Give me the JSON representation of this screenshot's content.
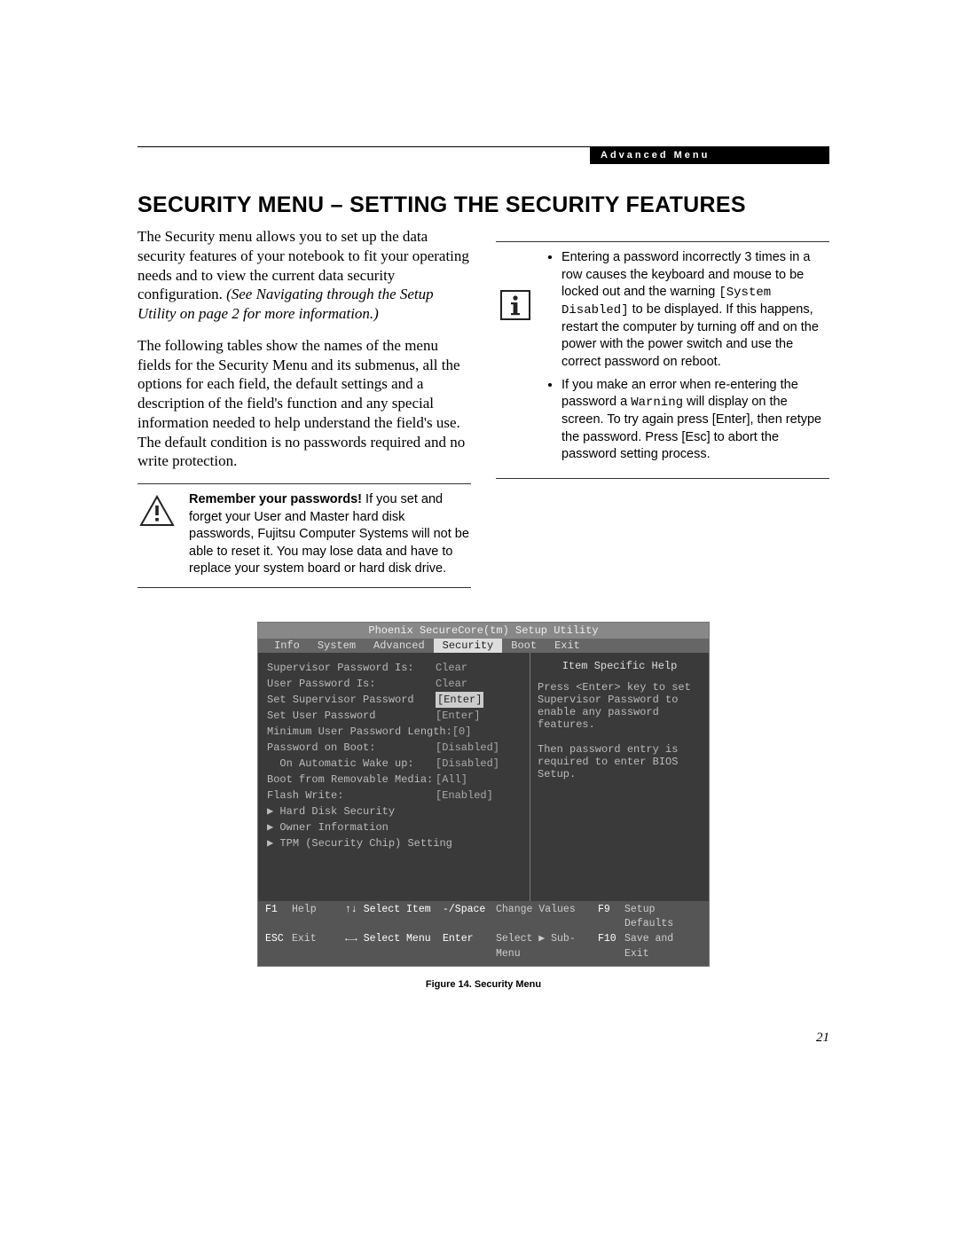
{
  "header": {
    "chapter": "Advanced Menu"
  },
  "title": "SECURITY MENU – SETTING THE SECURITY FEATURES",
  "left": {
    "p1a": "The Security menu allows you to set up the data security features of your notebook to fit your operating needs and to view the current data security configuration. ",
    "p1b": "(See Navigating through the Setup Utility on page 2 for more information.)",
    "p2": "The following tables show the names of the menu fields for the Security Menu and its submenus, all the options for each field, the default settings and a description of the field's function and any special information needed to help understand the field's use. The default condition is no passwords required and no write protection.",
    "callout_bold": "Remember your passwords!",
    "callout_rest": " If you set and forget your User and Master hard disk passwords, Fujitsu Computer Systems will not be able to reset it. You may lose data and have to replace your system board or hard disk drive."
  },
  "right": {
    "b1a": "Entering a password incorrectly 3 times in a row causes the keyboard and mouse to be locked out and the warning ",
    "b1code": "[System Disabled]",
    "b1b": " to be displayed. If this happens, restart the computer by turning off and on the power with the power switch and use the correct password on reboot.",
    "b2a": "If you make an error when re-entering the password a ",
    "b2code": "Warning",
    "b2b": " will display on the screen. To try again press [Enter], then retype the password. Press [Esc] to abort the password setting process."
  },
  "bios": {
    "title": "Phoenix SecureCore(tm) Setup Utility",
    "tabs": [
      "Info",
      "System",
      "Advanced",
      "Security",
      "Boot",
      "Exit"
    ],
    "selected_tab": "Security",
    "rows": [
      {
        "label": "Supervisor Password Is:",
        "value": "Clear",
        "active": false
      },
      {
        "label": "User Password Is:",
        "value": "Clear",
        "active": false
      },
      {
        "label": "",
        "value": "",
        "active": false
      },
      {
        "label": "Set Supervisor Password",
        "value": "[Enter]",
        "active": true
      },
      {
        "label": "Set User Password",
        "value": "[Enter]",
        "active": false
      },
      {
        "label": "Minimum User Password Length:",
        "value": "[0]",
        "active": false
      },
      {
        "label": "Password on Boot:",
        "value": "[Disabled]",
        "active": false
      },
      {
        "label": "  On Automatic Wake up:",
        "value": "[Disabled]",
        "active": false
      },
      {
        "label": "Boot from Removable Media:",
        "value": "[All]",
        "active": false
      },
      {
        "label": "Flash Write:",
        "value": "[Enabled]",
        "active": false
      },
      {
        "label": "▶ Hard Disk Security",
        "value": "",
        "active": false
      },
      {
        "label": "▶ Owner Information",
        "value": "",
        "active": false
      },
      {
        "label": "▶ TPM (Security Chip) Setting",
        "value": "",
        "active": false
      }
    ],
    "help_title": "Item Specific Help",
    "help_body": "Press <Enter> key to set Supervisor Password to enable any password features.\n\nThen password entry is required to enter BIOS Setup.",
    "footer": {
      "r1": {
        "a": "F1",
        "b": "Help",
        "c": "↑↓ Select Item",
        "d": "-/Space",
        "e": "Change Values",
        "f": "F9",
        "g": "Setup Defaults"
      },
      "r2": {
        "a": "ESC",
        "b": "Exit",
        "c": "←→ Select Menu",
        "d": "Enter",
        "e": "Select ▶ Sub-Menu",
        "f": "F10",
        "g": "Save and Exit"
      }
    }
  },
  "fig_caption": "Figure 14.  Security Menu",
  "pagenum": "21"
}
